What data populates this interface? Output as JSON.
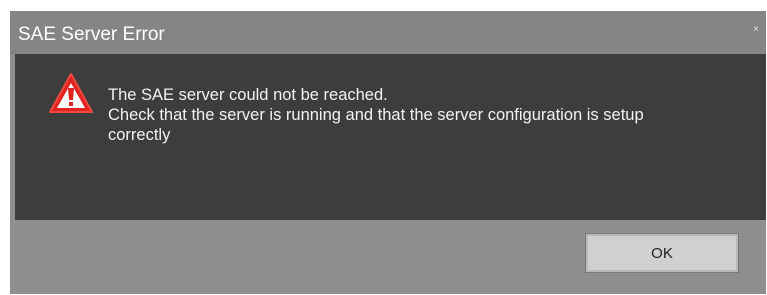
{
  "dialog": {
    "title": "SAE Server Error",
    "close_glyph": "×",
    "icon": "warning-icon",
    "message_lines": [
      "The SAE server could not be reached.",
      "Check that the server is running and that the server configuration is setup",
      "correctly"
    ],
    "ok_label": "OK"
  },
  "colors": {
    "titlebar": "#858585",
    "content_bg": "#3d3d3d",
    "footer_bg": "#8e8e8e",
    "warning_red": "#e0231f",
    "button_bg": "#d0d0d0"
  }
}
